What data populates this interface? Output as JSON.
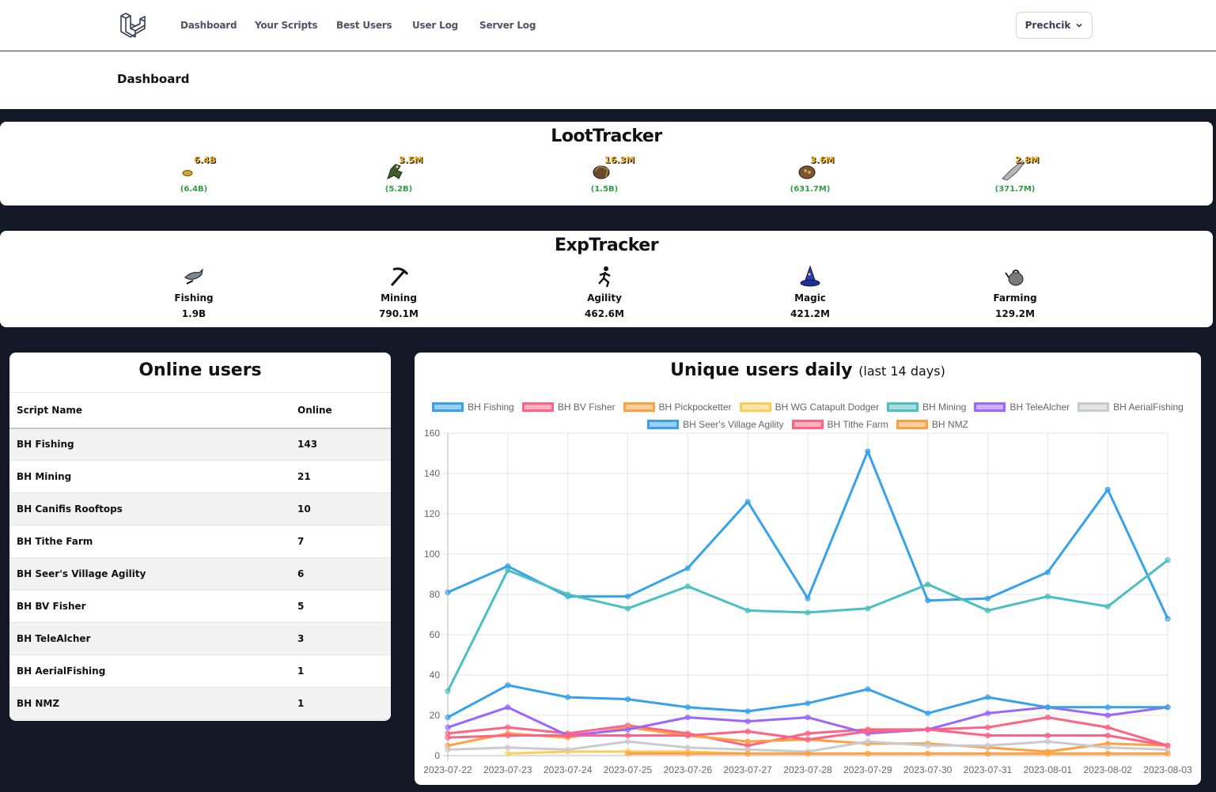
{
  "nav": {
    "links": [
      {
        "label": "Dashboard",
        "active": true
      },
      {
        "label": "Your Scripts",
        "active": false
      },
      {
        "label": "Best Users",
        "active": false
      },
      {
        "label": "User Log",
        "active": false
      },
      {
        "label": "Server Log",
        "active": false
      }
    ],
    "user": "Prechcik"
  },
  "page_title": "Dashboard",
  "loot_tracker": {
    "title": "LootTracker",
    "items": [
      {
        "icon": "coins-icon",
        "qty": "6.4B",
        "value": "(6.4B)"
      },
      {
        "icon": "dragon-hide-icon",
        "qty": "3.5M",
        "value": "(5.2B)"
      },
      {
        "icon": "bird-nest-icon",
        "qty": "16.3M",
        "value": "(1.5B)"
      },
      {
        "icon": "bird-nest-seeds-icon",
        "qty": "3.6M",
        "value": "(631.7M)"
      },
      {
        "icon": "raw-fish-icon",
        "qty": "2.8M",
        "value": "(371.7M)"
      }
    ]
  },
  "exp_tracker": {
    "title": "ExpTracker",
    "items": [
      {
        "icon": "fishing-icon",
        "name": "Fishing",
        "value": "1.9B"
      },
      {
        "icon": "mining-icon",
        "name": "Mining",
        "value": "790.1M"
      },
      {
        "icon": "agility-icon",
        "name": "Agility",
        "value": "462.6M"
      },
      {
        "icon": "magic-icon",
        "name": "Magic",
        "value": "421.2M"
      },
      {
        "icon": "farming-icon",
        "name": "Farming",
        "value": "129.2M"
      }
    ]
  },
  "online_users": {
    "title": "Online users",
    "columns": [
      "Script Name",
      "Online"
    ],
    "rows": [
      [
        "BH Fishing",
        "143"
      ],
      [
        "BH Mining",
        "21"
      ],
      [
        "BH Canifis Rooftops",
        "10"
      ],
      [
        "BH Tithe Farm",
        "7"
      ],
      [
        "BH Seer's Village Agility",
        "6"
      ],
      [
        "BH BV Fisher",
        "5"
      ],
      [
        "BH TeleAlcher",
        "3"
      ],
      [
        "BH AerialFishing",
        "1"
      ],
      [
        "BH NMZ",
        "1"
      ]
    ]
  },
  "chart_title": "Unique users daily",
  "chart_subtitle": "(last 14 days)",
  "chart_data": {
    "type": "line",
    "title": "Unique users daily (last 14 days)",
    "x": [
      "2023-07-22",
      "2023-07-23",
      "2023-07-24",
      "2023-07-25",
      "2023-07-26",
      "2023-07-27",
      "2023-07-28",
      "2023-07-29",
      "2023-07-30",
      "2023-07-31",
      "2023-08-01",
      "2023-08-02",
      "2023-08-03"
    ],
    "ylim": [
      0,
      160
    ],
    "yticks": [
      0,
      20,
      40,
      60,
      80,
      100,
      120,
      140,
      160
    ],
    "grid": true,
    "legend": "top",
    "series": [
      {
        "name": "BH Fishing",
        "color": "#36a2eb",
        "values": [
          81,
          94,
          79,
          79,
          93,
          126,
          78,
          151,
          77,
          78,
          91,
          132,
          68
        ]
      },
      {
        "name": "BH BV Fisher",
        "color": "#ff6384",
        "values": [
          11,
          14,
          11,
          15,
          11,
          5,
          11,
          13,
          13,
          14,
          19,
          14,
          5
        ]
      },
      {
        "name": "BH Pickpocketter",
        "color": "#ff9f40",
        "values": [
          5,
          11,
          9,
          14,
          10,
          7,
          8,
          6,
          6,
          4,
          2,
          6,
          5
        ]
      },
      {
        "name": "BH WG Catapult Dodger",
        "color": "#ffcd56",
        "values": [
          null,
          1,
          2,
          2,
          2,
          1,
          1,
          1,
          1,
          1,
          1,
          1,
          1
        ]
      },
      {
        "name": "BH Mining",
        "color": "#4bc0c0",
        "values": [
          32,
          92,
          80,
          73,
          84,
          72,
          71,
          73,
          85,
          72,
          79,
          74,
          97
        ]
      },
      {
        "name": "BH TeleAlcher",
        "color": "#9966ff",
        "values": [
          14,
          24,
          10,
          13,
          19,
          17,
          19,
          11,
          13,
          21,
          24,
          20,
          24
        ]
      },
      {
        "name": "BH AerialFishing",
        "color": "#c9cbcf",
        "values": [
          3,
          4,
          3,
          7,
          4,
          3,
          2,
          7,
          5,
          5,
          7,
          4,
          3
        ]
      },
      {
        "name": "BH Seer's Village Agility",
        "color": "#36a2eb",
        "values": [
          19,
          35,
          29,
          28,
          24,
          22,
          26,
          33,
          21,
          29,
          24,
          24,
          24
        ]
      },
      {
        "name": "BH Tithe Farm",
        "color": "#ff6384",
        "values": [
          9,
          10,
          10,
          10,
          10,
          12,
          8,
          12,
          13,
          10,
          10,
          10,
          5
        ]
      },
      {
        "name": "BH NMZ",
        "color": "#ff9f40",
        "values": [
          null,
          null,
          null,
          1,
          1,
          1,
          1,
          1,
          1,
          1,
          1,
          1,
          1
        ]
      }
    ]
  }
}
